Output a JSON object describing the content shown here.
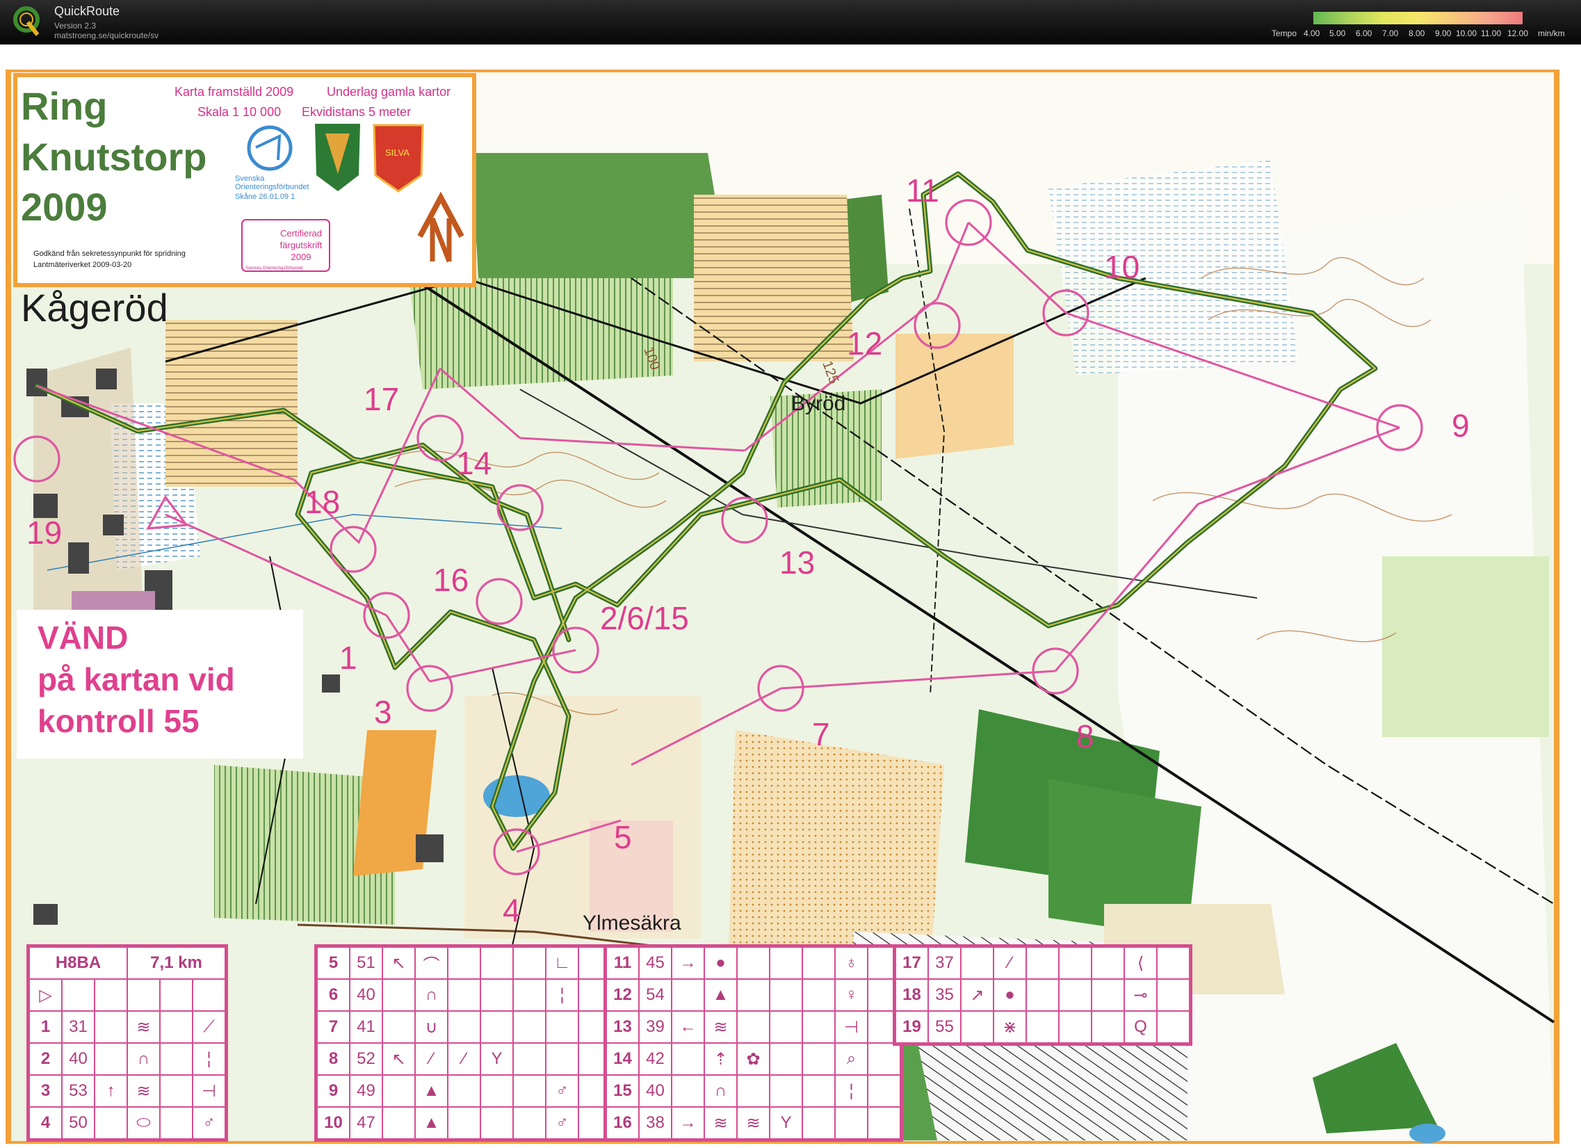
{
  "app": {
    "title": "QuickRoute",
    "version": "Version 2.3",
    "url": "matstroeng.se/quickroute/sv"
  },
  "tempo_legend": {
    "label": "Tempo",
    "ticks": [
      "4.00",
      "5.00",
      "6.00",
      "7.00",
      "8.00",
      "9.00",
      "10.00",
      "11.00",
      "12.00"
    ],
    "unit": "min/km"
  },
  "map_info": {
    "event_title_1": "Ring",
    "event_title_2": "Knutstorp",
    "event_title_3": "2009",
    "made": "Karta framställd 2009",
    "base": "Underlag gamla kartor",
    "scale": "Skala 1 10 000",
    "contour": "Ekvidistans 5 meter",
    "sof_1": "Svenska",
    "sof_2": "Orienteringsförbundet",
    "skane": "Skåne 26.01.09 1",
    "club_badge": "SILVA",
    "permit_1": "Godkänd från sekretessynpunkt för spridning",
    "permit_2": "Lantmäteriverket 2009-03-20",
    "cert_1": "Certifierad",
    "cert_2": "färgutskrift",
    "cert_3": "2009",
    "cert_small": "Svenska Orienteringsförbundet"
  },
  "place_names": {
    "kagerod": "Kågeröd",
    "byrod": "Byröd",
    "ylmesakra": "Ylmesäkra"
  },
  "contour_labels": [
    "100",
    "125"
  ],
  "control_labels": {
    "c1": "1",
    "c3": "3",
    "c4": "4",
    "c5": "5",
    "c7": "7",
    "c8": "8",
    "c9": "9",
    "c10": "10",
    "c11": "11",
    "c12": "12",
    "c13": "13",
    "c14": "14",
    "c16": "16",
    "c17": "17",
    "c18": "18",
    "c19": "19",
    "c2615": "2/6/15"
  },
  "turn_note": {
    "line1": "VÄND",
    "line2": "på kartan vid",
    "line3": "kontroll 55"
  },
  "description_sheet": {
    "class": "H8BA",
    "length": "7,1 km",
    "panel1": [
      {
        "no": "1",
        "code": "31"
      },
      {
        "no": "2",
        "code": "40"
      },
      {
        "no": "3",
        "code": "53"
      },
      {
        "no": "4",
        "code": "50"
      }
    ],
    "panel2": [
      {
        "no": "5",
        "code": "51"
      },
      {
        "no": "6",
        "code": "40"
      },
      {
        "no": "7",
        "code": "41"
      },
      {
        "no": "8",
        "code": "52"
      },
      {
        "no": "9",
        "code": "49"
      },
      {
        "no": "10",
        "code": "47"
      }
    ],
    "panel3": [
      {
        "no": "11",
        "code": "45"
      },
      {
        "no": "12",
        "code": "54"
      },
      {
        "no": "13",
        "code": "39"
      },
      {
        "no": "14",
        "code": "42"
      },
      {
        "no": "15",
        "code": "40"
      },
      {
        "no": "16",
        "code": "38"
      }
    ],
    "panel4": [
      {
        "no": "17",
        "code": "37"
      },
      {
        "no": "18",
        "code": "35"
      },
      {
        "no": "19",
        "code": "55"
      }
    ]
  }
}
